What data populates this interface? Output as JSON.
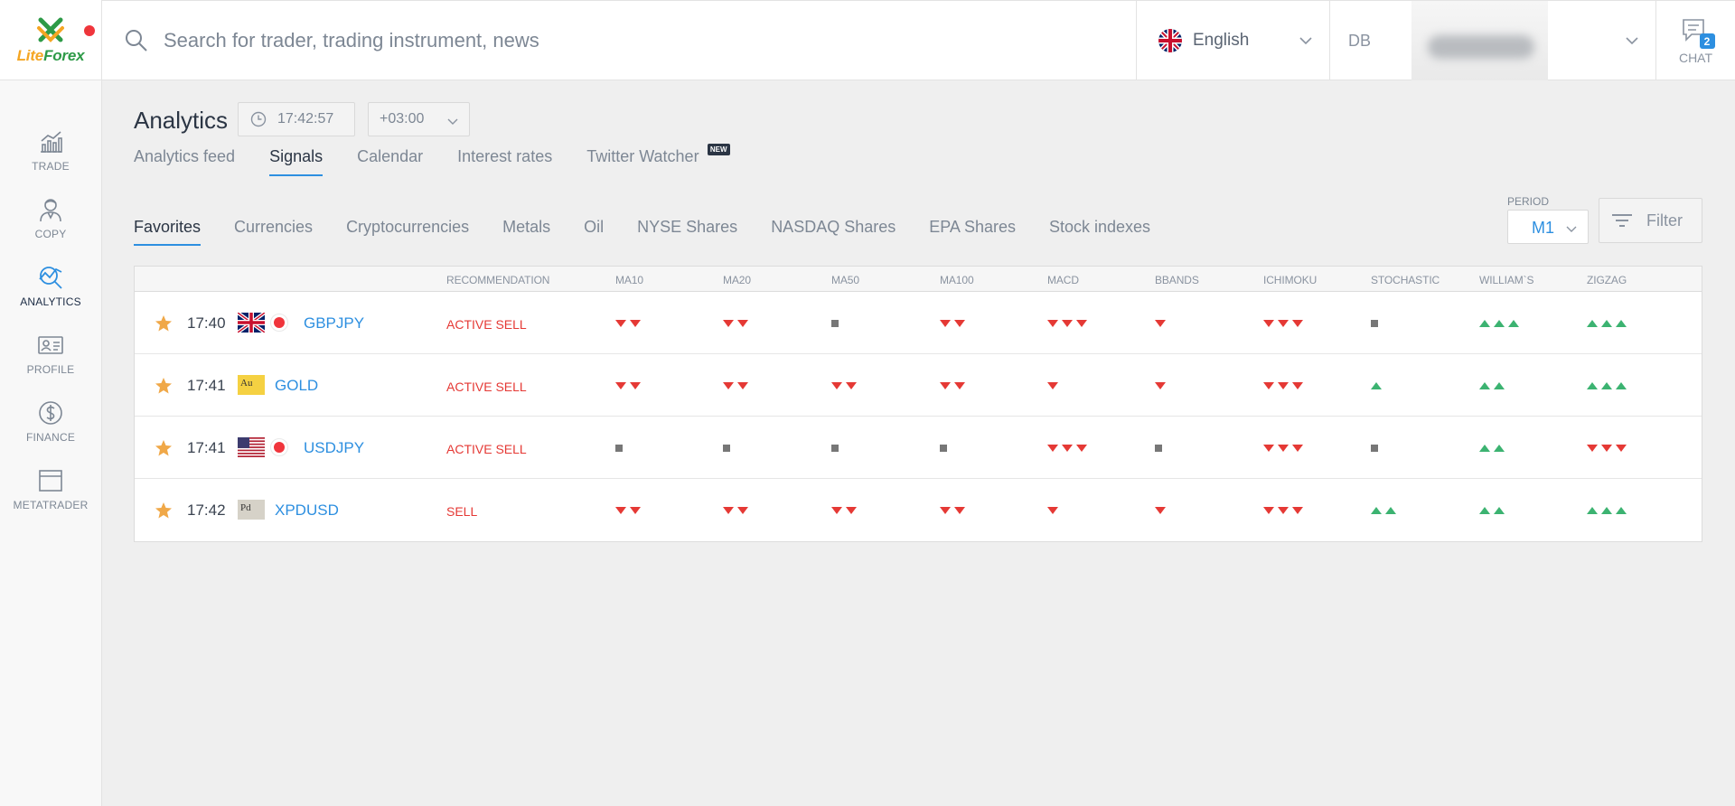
{
  "app": {
    "logo_text_lite": "Lite",
    "logo_text_forex": "Forex"
  },
  "sidebar": {
    "items": [
      {
        "label": "TRADE",
        "icon": "chart-icon",
        "active": false
      },
      {
        "label": "COPY",
        "icon": "trader-icon",
        "active": false
      },
      {
        "label": "ANALYTICS",
        "icon": "analytics-icon",
        "active": true
      },
      {
        "label": "PROFILE",
        "icon": "profile-card-icon",
        "active": false
      },
      {
        "label": "FINANCE",
        "icon": "dollar-icon",
        "active": false
      },
      {
        "label": "METATRADER",
        "icon": "window-icon",
        "active": false
      }
    ]
  },
  "topbar": {
    "search_placeholder": "Search for trader, trading instrument, news",
    "language": "English",
    "account_prefix": "DB",
    "chat_label": "CHAT",
    "chat_count": "2"
  },
  "page": {
    "title": "Analytics",
    "clock": "17:42:57",
    "timezone": "+03:00"
  },
  "tabs": [
    {
      "label": "Analytics feed",
      "active": false
    },
    {
      "label": "Signals",
      "active": true
    },
    {
      "label": "Calendar",
      "active": false
    },
    {
      "label": "Interest rates",
      "active": false
    },
    {
      "label": "Twitter Watcher",
      "active": false,
      "badge": "NEW"
    }
  ],
  "subtabs": [
    {
      "label": "Favorites",
      "active": true
    },
    {
      "label": "Currencies",
      "active": false
    },
    {
      "label": "Cryptocurrencies",
      "active": false
    },
    {
      "label": "Metals",
      "active": false
    },
    {
      "label": "Oil",
      "active": false
    },
    {
      "label": "NYSE Shares",
      "active": false
    },
    {
      "label": "NASDAQ Shares",
      "active": false
    },
    {
      "label": "EPA Shares",
      "active": false
    },
    {
      "label": "Stock indexes",
      "active": false
    }
  ],
  "period": {
    "label": "PERIOD",
    "value": "M1"
  },
  "filter_label": "Filter",
  "table": {
    "columns": [
      "RECOMMENDATION",
      "MA10",
      "MA20",
      "MA50",
      "MA100",
      "MACD",
      "BBANDS",
      "ICHIMOKU",
      "STOCHASTIC",
      "WILLIAM`S",
      "ZIGZAG"
    ],
    "rows": [
      {
        "time": "17:40",
        "symbol": "GBPJPY",
        "flag": "gb-flag-jp-dot",
        "recommendation": "ACTIVE SELL",
        "signals": [
          "down2",
          "down2",
          "neutral",
          "down2",
          "down3",
          "down1",
          "down3",
          "neutral",
          "up3",
          "up3"
        ]
      },
      {
        "time": "17:41",
        "symbol": "GOLD",
        "flag": "gold-au",
        "recommendation": "ACTIVE SELL",
        "signals": [
          "down2",
          "down2",
          "down2",
          "down2",
          "down1",
          "down1",
          "down3",
          "up1",
          "up2",
          "up3"
        ]
      },
      {
        "time": "17:41",
        "symbol": "USDJPY",
        "flag": "us-flag-jp-dot",
        "recommendation": "ACTIVE SELL",
        "signals": [
          "neutral",
          "neutral",
          "neutral",
          "neutral",
          "down3",
          "neutral",
          "down3",
          "neutral",
          "up2",
          "down3"
        ]
      },
      {
        "time": "17:42",
        "symbol": "XPDUSD",
        "flag": "palladium-pd",
        "recommendation": "SELL",
        "signals": [
          "down2",
          "down2",
          "down2",
          "down2",
          "down1",
          "down1",
          "down3",
          "up2",
          "up2",
          "up3"
        ]
      }
    ]
  },
  "colors": {
    "accent": "#2d8fe0",
    "sell": "#e53935",
    "buy": "#3cb371",
    "neutral": "#777777",
    "star": "#f0a848"
  }
}
